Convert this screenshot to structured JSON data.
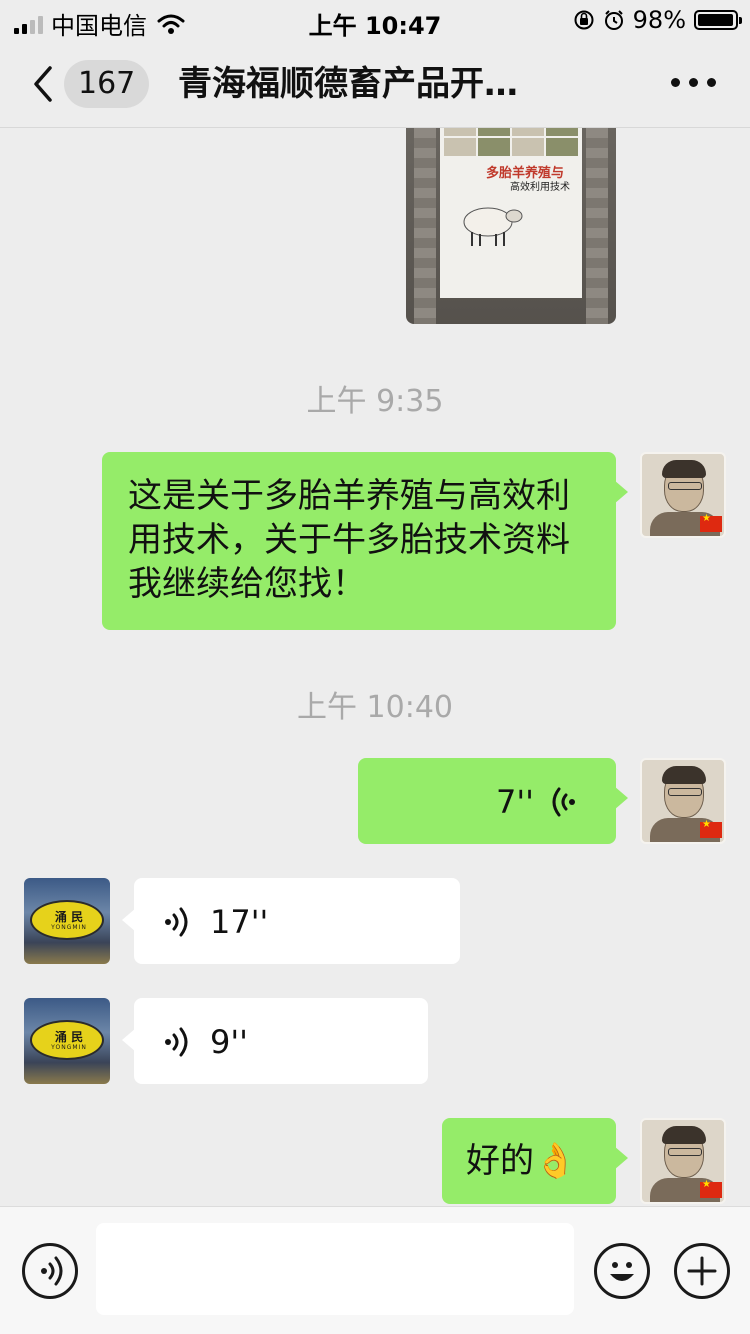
{
  "status_bar": {
    "carrier": "中国电信",
    "time": "上午 10:47",
    "battery_percent": "98%",
    "battery_level": 0.98,
    "icons": [
      "signal-icon",
      "wifi-icon",
      "orientation-lock-icon",
      "alarm-icon",
      "battery-icon"
    ]
  },
  "nav": {
    "unread_count": "167",
    "title": "青海福顺德畜产品开…",
    "icons": [
      "back-chevron-icon",
      "more-dots-icon"
    ]
  },
  "book_image": {
    "title": "多胎羊养殖与",
    "subtitle": "高效利用技术"
  },
  "messages": [
    {
      "type": "timestamp",
      "text": "上午 9:35"
    },
    {
      "type": "text",
      "direction": "sent",
      "text": "这是关于多胎羊养殖与高效利用技术，关于牛多胎技术资料我继续给您找！"
    },
    {
      "type": "timestamp",
      "text": "上午 10:40"
    },
    {
      "type": "voice",
      "direction": "sent",
      "duration": "7''"
    },
    {
      "type": "voice",
      "direction": "received",
      "duration": "17''"
    },
    {
      "type": "voice",
      "direction": "received",
      "duration": "9''"
    },
    {
      "type": "text",
      "direction": "sent",
      "text": "好的👌"
    }
  ],
  "other_avatar": {
    "logo_text": "涌 民",
    "logo_sub": "YONGMIN"
  },
  "input_bar": {
    "icons": [
      "voice-input-icon",
      "emoji-icon",
      "plus-icon"
    ],
    "placeholder": ""
  },
  "colors": {
    "background": "#ededed",
    "sent_bubble": "#95ec69",
    "received_bubble": "#ffffff",
    "timestamp": "#a9a9a9"
  }
}
